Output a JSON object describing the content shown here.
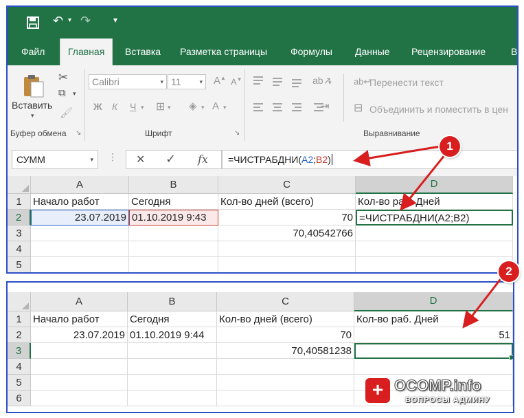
{
  "title_bar": {
    "save_icon": "save-icon",
    "undo_icon": "undo-icon",
    "redo_icon": "redo-icon",
    "qat_more_icon": "chevron-down-icon"
  },
  "tabs": [
    {
      "label": "Файл"
    },
    {
      "label": "Главная",
      "active": true
    },
    {
      "label": "Вставка"
    },
    {
      "label": "Разметка страницы"
    },
    {
      "label": "Формулы"
    },
    {
      "label": "Данные"
    },
    {
      "label": "Рецензирование"
    },
    {
      "label": "В"
    }
  ],
  "ribbon": {
    "clipboard": {
      "paste_label": "Вставить",
      "group_label": "Буфер обмена"
    },
    "font": {
      "font_name": "Calibri",
      "font_size": "11",
      "bold": "Ж",
      "italic": "К",
      "underline": "Ч",
      "group_label": "Шрифт"
    },
    "alignment": {
      "wrap_text": "Перенести текст",
      "merge_center": "Объединить и поместить в цен",
      "group_label": "Выравнивание"
    }
  },
  "formula_bar": {
    "name_box": "СУММ",
    "cancel_symbol": "✕",
    "confirm_symbol": "✓",
    "fx_symbol": "fx",
    "formula_prefix": "=ЧИСТРАБДНИ(",
    "ref_a": "A2",
    "separator": ";",
    "ref_b": "B2",
    "formula_suffix": ")"
  },
  "sheet1": {
    "columns": [
      "A",
      "B",
      "C",
      "D"
    ],
    "rows": [
      "1",
      "2",
      "3",
      "4",
      "5"
    ],
    "cells": {
      "a1": "Начало работ",
      "b1": "Сегодня",
      "c1": "Кол-во дней (всего)",
      "d1": "Кол-во раб. Дней",
      "a2": "23.07.2019",
      "b2": "01.10.2019 9:43",
      "c2": "70",
      "d2": "=ЧИСТРАБДНИ(A2;B2)",
      "c3": "70,40542766"
    }
  },
  "sheet2": {
    "columns": [
      "A",
      "B",
      "C",
      "D"
    ],
    "rows": [
      "1",
      "2",
      "3",
      "4",
      "5",
      "6"
    ],
    "cells": {
      "a1": "Начало работ",
      "b1": "Сегодня",
      "c1": "Кол-во дней (всего)",
      "d1": "Кол-во раб. Дней",
      "a2": "23.07.2019",
      "b2": "01.10.2019 9:44",
      "c2": "70",
      "d2": "51",
      "c3": "70,40581238"
    }
  },
  "annotations": {
    "badge1": "1",
    "badge2": "2"
  },
  "watermark": {
    "brand": "OCOMP.info",
    "tagline": "ВОПРОСЫ АДМИНУ",
    "accent": "#d81e1e"
  },
  "colors": {
    "excel_green": "#217346",
    "frame_blue": "#2b4fc7",
    "arrow_red": "#d81e1e"
  }
}
